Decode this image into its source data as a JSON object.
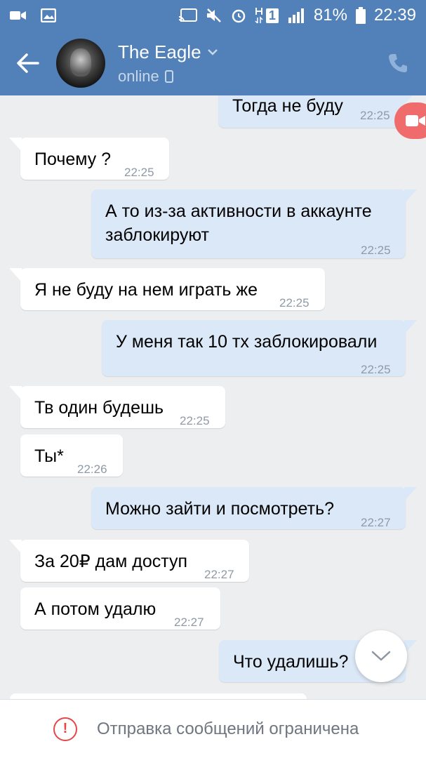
{
  "status_bar": {
    "battery": "81%",
    "time": "22:39",
    "sim": "1",
    "icons": [
      "video-notification-icon",
      "image-notification-icon",
      "cast-icon",
      "mute-icon",
      "alarm-icon",
      "data-icon",
      "signal-icon",
      "battery-icon"
    ]
  },
  "header": {
    "name": "The Eagle",
    "status": "online",
    "accent": "#5181b8"
  },
  "messages": [
    {
      "dir": "out",
      "text": "Тогда не буду",
      "time": "22:25"
    },
    {
      "dir": "in",
      "text": "Почему ?",
      "time": "22:25"
    },
    {
      "dir": "out",
      "text": "А то из-за активности в аккаунте заблокируют",
      "time": "22:25"
    },
    {
      "dir": "in",
      "text": "Я не буду на нем играть же",
      "time": "22:25"
    },
    {
      "dir": "out",
      "text": "У меня так 10 тх заблокировали",
      "time": "22:25"
    },
    {
      "dir": "in",
      "text": "Тв один будешь",
      "time": "22:25"
    },
    {
      "dir": "in",
      "text": "Ты*",
      "time": "22:26"
    },
    {
      "dir": "out",
      "text": "Можно зайти и посмотреть?",
      "time": "22:27"
    },
    {
      "dir": "in",
      "text": "За 20₽ дам доступ",
      "time": "22:27"
    },
    {
      "dir": "in",
      "text": "А потом удалю",
      "time": "22:27"
    },
    {
      "dir": "out",
      "text": "Что удалишь?",
      "time": ""
    }
  ],
  "bottom_bar": {
    "notice": "Отправка сообщений ограничена",
    "warning_color": "#e64646"
  }
}
